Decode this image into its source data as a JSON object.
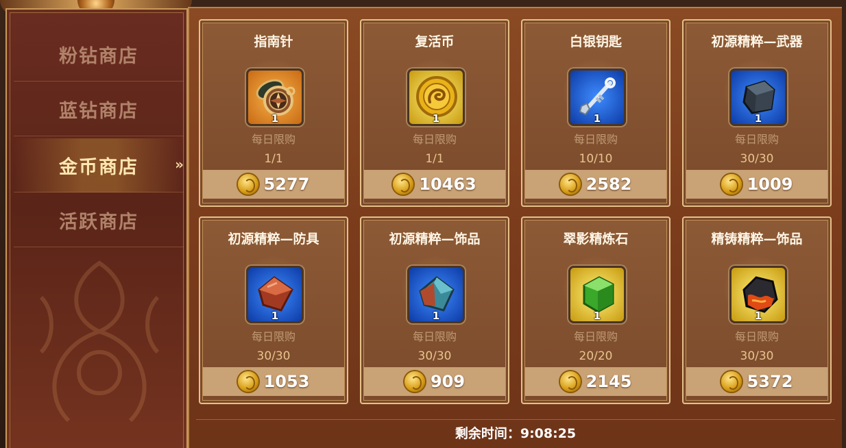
{
  "sidebar": {
    "items": [
      {
        "label": "粉钻商店"
      },
      {
        "label": "蓝钻商店"
      },
      {
        "label": "金币商店",
        "active": true
      },
      {
        "label": "活跃商店"
      }
    ],
    "active_marker": "»"
  },
  "shop": {
    "cards": [
      {
        "name": "指南针",
        "icon": "compass-icon",
        "box": "orange",
        "qty": "1",
        "limit_label": "每日限购",
        "limit": "1/1",
        "price": "5277"
      },
      {
        "name": "复活币",
        "icon": "revive-coin-icon",
        "box": "gold",
        "qty": "1",
        "limit_label": "每日限购",
        "limit": "1/1",
        "price": "10463"
      },
      {
        "name": "白银钥匙",
        "icon": "silver-key-icon",
        "box": "blue",
        "qty": "1",
        "limit_label": "每日限购",
        "limit": "10/10",
        "price": "2582"
      },
      {
        "name": "初源精粹—武器",
        "icon": "weapon-essence-icon",
        "box": "blue",
        "qty": "1",
        "limit_label": "每日限购",
        "limit": "30/30",
        "price": "1009"
      },
      {
        "name": "初源精粹—防具",
        "icon": "armor-essence-icon",
        "box": "blue",
        "qty": "1",
        "limit_label": "每日限购",
        "limit": "30/30",
        "price": "1053"
      },
      {
        "name": "初源精粹—饰品",
        "icon": "accessory-essence-icon",
        "box": "blue",
        "qty": "1",
        "limit_label": "每日限购",
        "limit": "30/30",
        "price": "909"
      },
      {
        "name": "翠影精炼石",
        "icon": "green-refine-stone-icon",
        "box": "gold",
        "qty": "1",
        "limit_label": "每日限购",
        "limit": "20/20",
        "price": "2145"
      },
      {
        "name": "精铸精粹—饰品",
        "icon": "forge-essence-icon",
        "box": "gold",
        "qty": "1",
        "limit_label": "每日限购",
        "limit": "30/30",
        "price": "5372"
      }
    ]
  },
  "footer": {
    "timer_text": "剩余时间：9:08:25"
  },
  "colors": {
    "accent_gold": "#e6c189",
    "price_bar": "#c9a276",
    "active_tab_text": "#ffe7b0"
  }
}
